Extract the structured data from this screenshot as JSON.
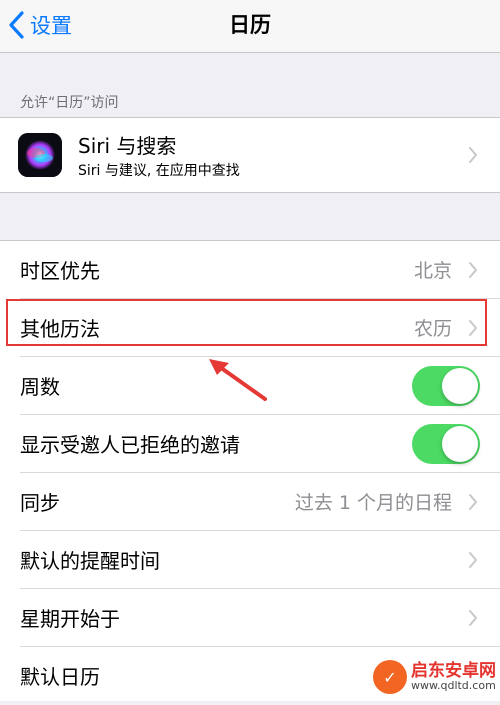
{
  "navbar": {
    "back_label": "设置",
    "title": "日历"
  },
  "siri_section": {
    "header": "允许“日历”访问",
    "title": "Siri 与搜索",
    "subtitle": "Siri 与建议, 在应用中查找"
  },
  "settings": {
    "rows": [
      {
        "label": "时区优先",
        "value": "北京"
      },
      {
        "label": "其他历法",
        "value": "农历"
      },
      {
        "label": "周数",
        "toggle": true
      },
      {
        "label": "显示受邀人已拒绝的邀请",
        "toggle": true
      },
      {
        "label": "同步",
        "value": "过去 1 个月的日程"
      },
      {
        "label": "默认的提醒时间",
        "value": ""
      },
      {
        "label": "星期开始于",
        "value": ""
      },
      {
        "label": "默认日历",
        "value": ""
      }
    ]
  },
  "colors": {
    "accent": "#0a7aff",
    "toggle_on": "#4cd964",
    "highlight": "#e53935"
  },
  "watermark": {
    "name": "启东安卓网",
    "url": "www.qdltd.com"
  }
}
